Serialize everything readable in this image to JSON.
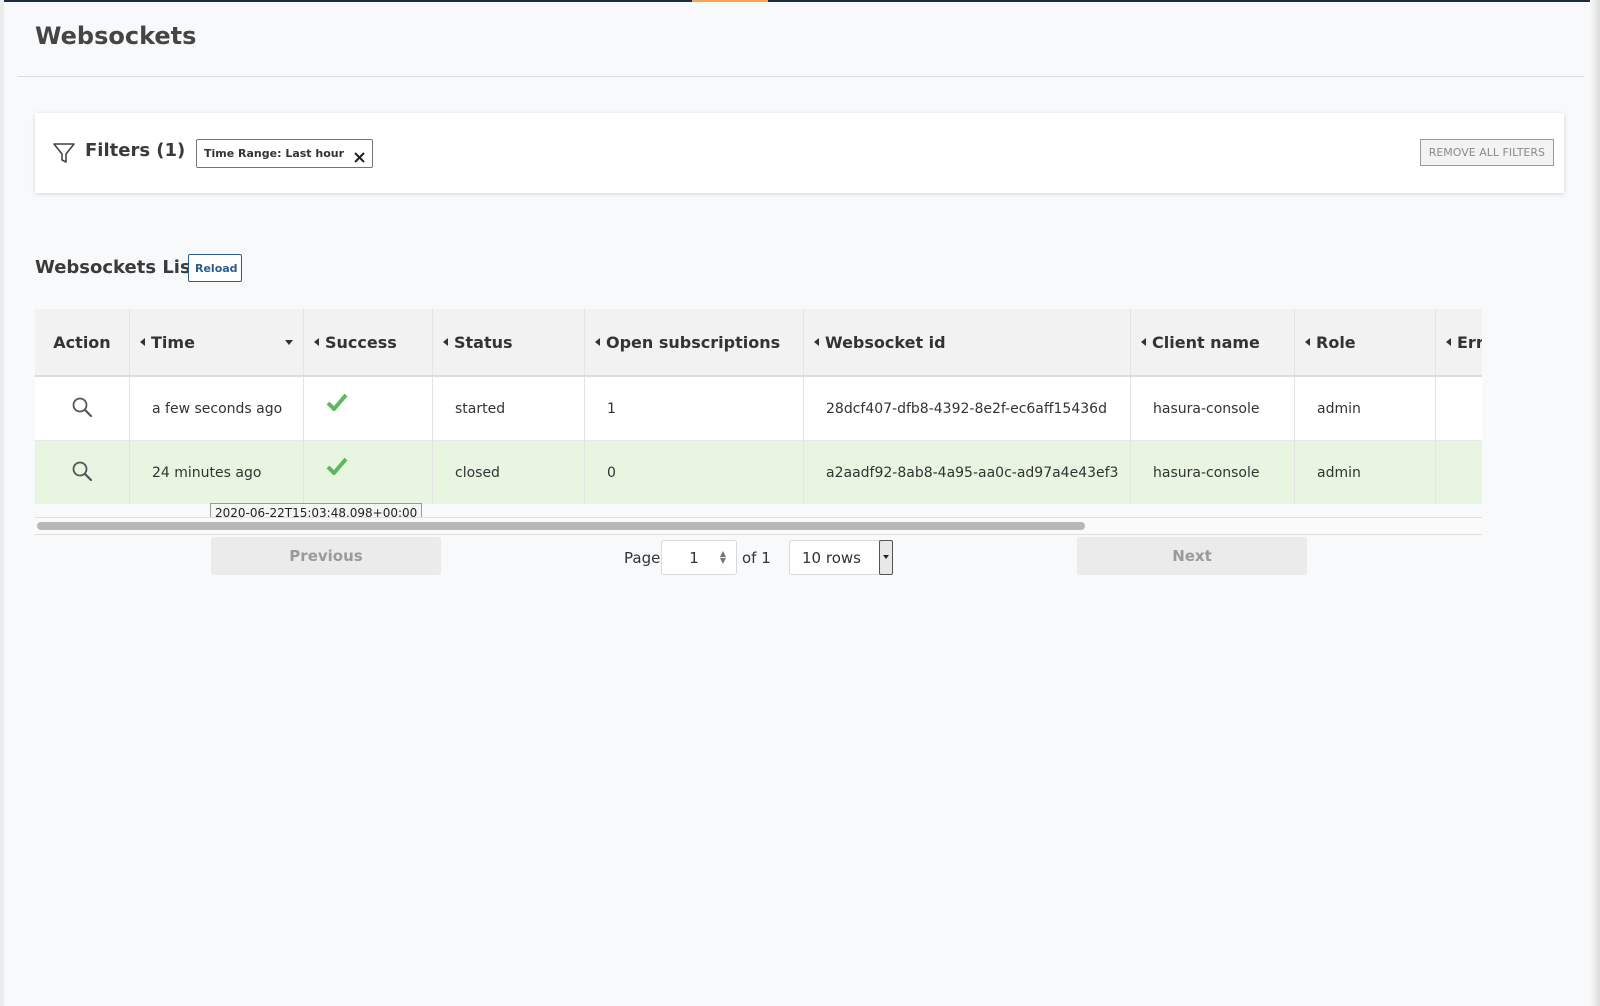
{
  "page": {
    "title": "Websockets"
  },
  "filters": {
    "label": "Filters (1)",
    "chips": [
      {
        "label": "Time Range: Last hour"
      }
    ],
    "remove_all_label": "REMOVE ALL FILTERS"
  },
  "list": {
    "title": "Websockets List",
    "reload_label": "Reload"
  },
  "table": {
    "columns": [
      "Action",
      "Time",
      "Success",
      "Status",
      "Open subscriptions",
      "Websocket id",
      "Client name",
      "Role",
      "Errors"
    ],
    "rows": [
      {
        "time": "a few seconds ago",
        "success": true,
        "status": "started",
        "open_subscriptions": "1",
        "websocket_id": "28dcf407-dfb8-4392-8e2f-ec6aff15436d",
        "client_name": "hasura-console",
        "role": "admin"
      },
      {
        "time": "24 minutes ago",
        "success": true,
        "status": "closed",
        "open_subscriptions": "0",
        "websocket_id": "a2aadf92-8ab8-4a95-aa0c-ad97a4e43ef3",
        "client_name": "hasura-console",
        "role": "admin"
      }
    ],
    "tooltip": "2020-06-22T15:03:48.098+00:00"
  },
  "pagination": {
    "previous_label": "Previous",
    "next_label": "Next",
    "page_label": "Page",
    "current_page": "1",
    "of_label": "of 1",
    "rows_label": "10 rows"
  },
  "colors": {
    "success": "#5cb85c",
    "highlight_row": "#e8f5e0",
    "accent": "#2a5b8a"
  },
  "icons": {
    "filter": "filter-icon",
    "close": "close-icon",
    "search": "search-icon",
    "check": "check-icon"
  }
}
